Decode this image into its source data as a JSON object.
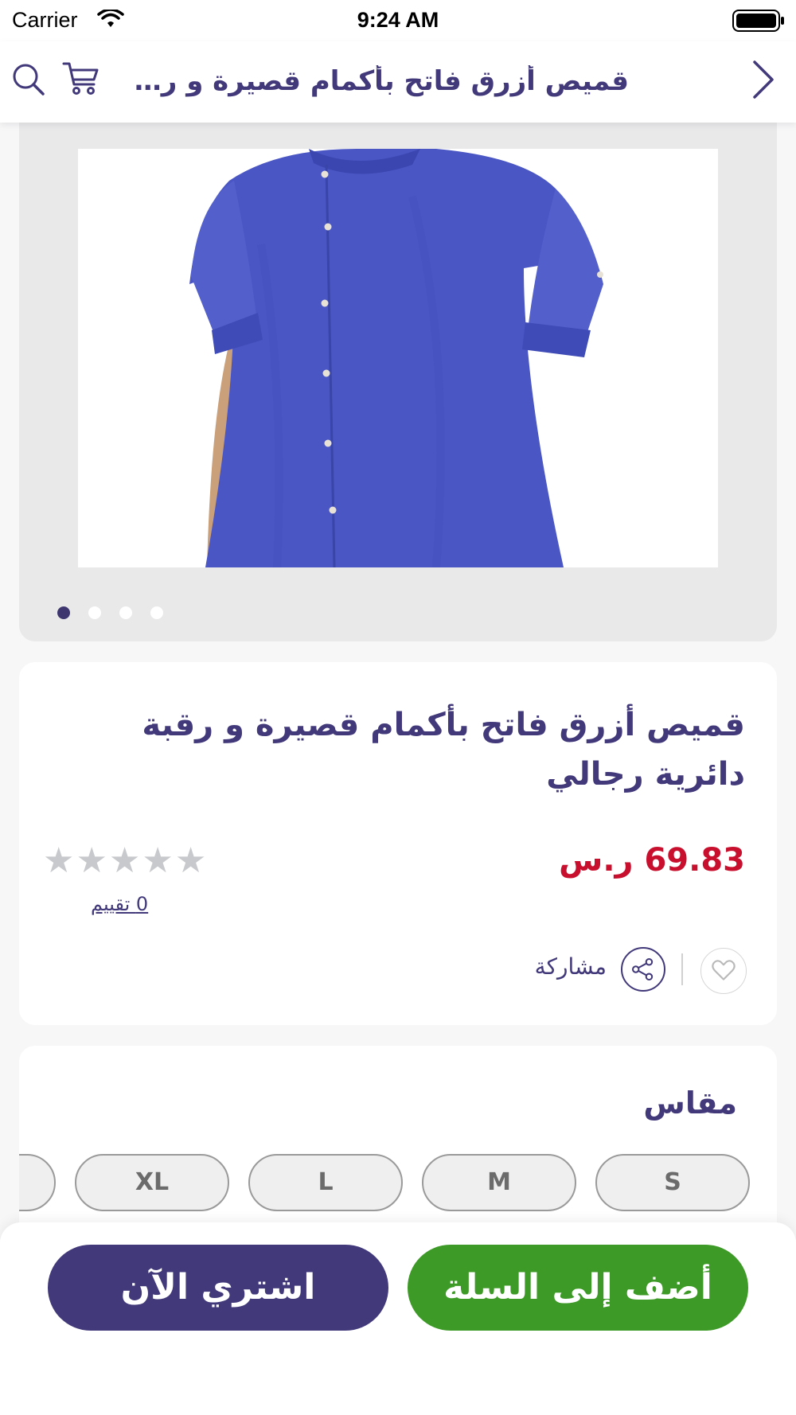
{
  "status_bar": {
    "carrier": "Carrier",
    "time": "9:24 AM"
  },
  "nav": {
    "title": "قميص أزرق فاتح بأكمام قصيرة و رقبة دائرية رجالي",
    "icons": [
      "search-icon",
      "cart-icon",
      "chevron-right-icon"
    ]
  },
  "gallery": {
    "image_count": 4,
    "active_index": 0
  },
  "product": {
    "title": "قميص أزرق فاتح بأكمام قصيرة و رقبة دائرية رجالي",
    "price": "69.83 ر.س",
    "rating": 0,
    "max_rating": 5,
    "reviews": "0  تقييم",
    "share_label": "مشاركة"
  },
  "sizes": {
    "label": "مقاس",
    "options": [
      "S",
      "M",
      "L",
      "XL",
      ""
    ]
  },
  "actions": {
    "add_to_cart": "أضف إلى السلة",
    "buy_now": "اشتري الآن"
  },
  "colors": {
    "brand_purple": "#41397a",
    "price_red": "#c8102e",
    "cart_green": "#3e9a27",
    "shirt_blue": "#4a56c4"
  }
}
